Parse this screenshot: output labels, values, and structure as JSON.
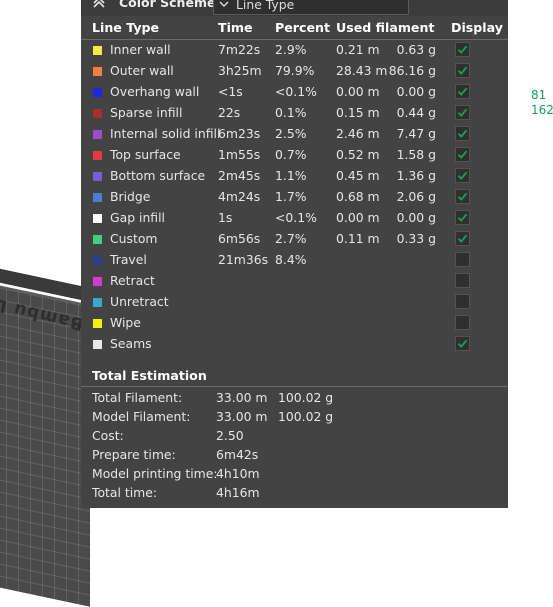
{
  "panel": {
    "scheme_label": "Color Scheme",
    "scheme_value": "Line Type"
  },
  "headers": {
    "line_type": "Line Type",
    "time": "Time",
    "percent": "Percent",
    "used_filament": "Used filament",
    "display": "Display"
  },
  "rows": [
    {
      "name": "Inner wall",
      "color": "#f4e94a",
      "time": "7m22s",
      "percent": "2.9%",
      "length": "0.21 m",
      "weight": "0.63 g",
      "display": true
    },
    {
      "name": "Outer wall",
      "color": "#f0803c",
      "time": "3h25m",
      "percent": "79.9%",
      "length": "28.43 m",
      "weight": "86.16 g",
      "display": true
    },
    {
      "name": "Overhang wall",
      "color": "#1e27e8",
      "time": "<1s",
      "percent": "<0.1%",
      "length": "0.00 m",
      "weight": "0.00 g",
      "display": true
    },
    {
      "name": "Sparse infill",
      "color": "#a5302f",
      "time": "22s",
      "percent": "0.1%",
      "length": "0.15 m",
      "weight": "0.44 g",
      "display": true
    },
    {
      "name": "Internal solid infill",
      "color": "#9b4ec8",
      "time": "6m23s",
      "percent": "2.5%",
      "length": "2.46 m",
      "weight": "7.47 g",
      "display": true
    },
    {
      "name": "Top surface",
      "color": "#e83a3a",
      "time": "1m55s",
      "percent": "0.7%",
      "length": "0.52 m",
      "weight": "1.58 g",
      "display": true
    },
    {
      "name": "Bottom surface",
      "color": "#7a5cd6",
      "time": "2m45s",
      "percent": "1.1%",
      "length": "0.45 m",
      "weight": "1.36 g",
      "display": true
    },
    {
      "name": "Bridge",
      "color": "#4a7ed0",
      "time": "4m24s",
      "percent": "1.7%",
      "length": "0.68 m",
      "weight": "2.06 g",
      "display": true
    },
    {
      "name": "Gap infill",
      "color": "#ffffff",
      "time": "1s",
      "percent": "<0.1%",
      "length": "0.00 m",
      "weight": "0.00 g",
      "display": true
    },
    {
      "name": "Custom",
      "color": "#43cf82",
      "time": "6m56s",
      "percent": "2.7%",
      "length": "0.11 m",
      "weight": "0.33 g",
      "display": true
    },
    {
      "name": "Travel",
      "color": "#2c3e8c",
      "time": "21m36s",
      "percent": "8.4%",
      "length": "",
      "weight": "",
      "display": false
    },
    {
      "name": "Retract",
      "color": "#d03ccd",
      "time": "",
      "percent": "",
      "length": "",
      "weight": "",
      "display": false
    },
    {
      "name": "Unretract",
      "color": "#39a8c9",
      "time": "",
      "percent": "",
      "length": "",
      "weight": "",
      "display": false
    },
    {
      "name": "Wipe",
      "color": "#f2f20f",
      "time": "",
      "percent": "",
      "length": "",
      "weight": "",
      "display": false
    },
    {
      "name": "Seams",
      "color": "#e8e8e8",
      "time": "",
      "percent": "",
      "length": "",
      "weight": "",
      "display": true
    }
  ],
  "estimation": {
    "title": "Total Estimation",
    "items": [
      {
        "label": "Total Filament:",
        "v1": "33.00 m",
        "v2": "100.02 g"
      },
      {
        "label": "Model Filament:",
        "v1": "33.00 m",
        "v2": "100.02 g"
      },
      {
        "label": "Cost:",
        "v1": "2.50",
        "v2": ""
      },
      {
        "label": "Prepare time:",
        "v1": "6m42s",
        "v2": ""
      },
      {
        "label": "Model printing time:",
        "v1": "4h10m",
        "v2": ""
      },
      {
        "label": "Total time:",
        "v1": "4h16m",
        "v2": ""
      }
    ]
  },
  "viewport": {
    "plate_logo": "Bambu L",
    "readout_1": "81",
    "readout_2": "162"
  },
  "colors": {
    "panel_bg": "#434343",
    "check_accent": "#15a35a"
  }
}
